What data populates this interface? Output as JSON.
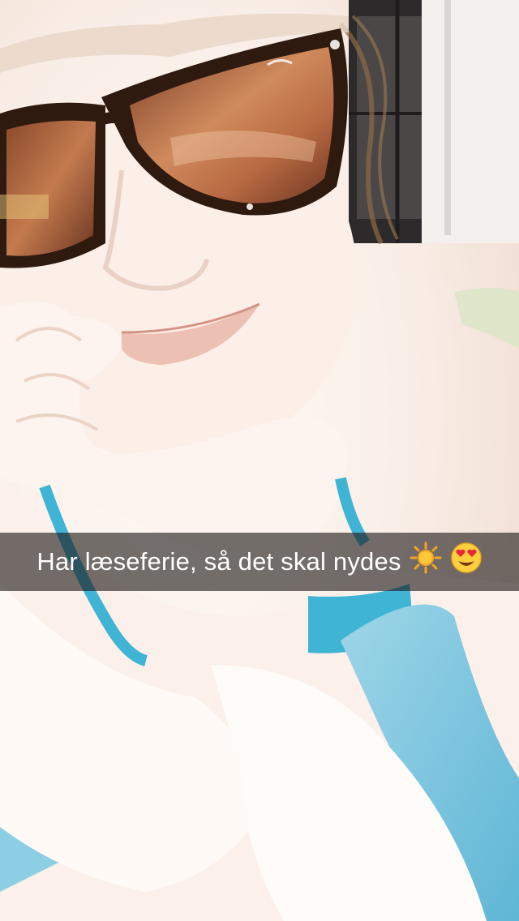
{
  "snap": {
    "caption": "Har læseferie, så det skal nydes",
    "emojis": [
      "sun-emoji",
      "heart-eyes-emoji"
    ]
  },
  "colors": {
    "caption_bar": "#1e1a18",
    "caption_text": "#ffffff",
    "swimsuit": "#3fb4d4",
    "towel": "#7fc6de",
    "sunglass_frame": "#3a1f12",
    "lens": "#b0603a"
  }
}
